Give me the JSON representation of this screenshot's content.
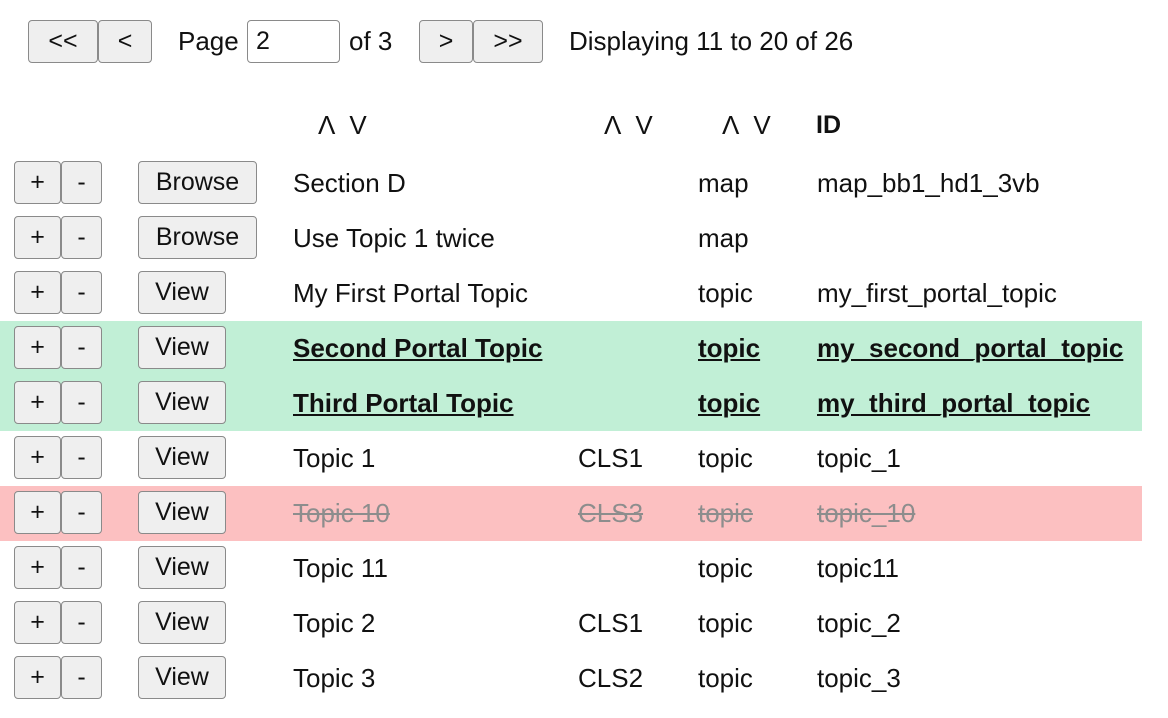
{
  "pager": {
    "first_label": "<<",
    "prev_label": "<",
    "page_label": "Page",
    "page_value": "2",
    "of_label": "of 3",
    "next_label": ">",
    "last_label": ">>",
    "status": "Displaying 11 to 20 of 26"
  },
  "header": {
    "sort_up": "Λ",
    "sort_down": "V",
    "id_label": "ID"
  },
  "rows": [
    {
      "state": "normal",
      "action": "Browse",
      "title": "Section D",
      "cls": "",
      "type": "map",
      "id": "map_bb1_hd1_3vb"
    },
    {
      "state": "normal",
      "action": "Browse",
      "title": "Use Topic 1 twice",
      "cls": "",
      "type": "map",
      "id": ""
    },
    {
      "state": "normal",
      "action": "View",
      "title": "My First Portal Topic",
      "cls": "",
      "type": "topic",
      "id": "my_first_portal_topic"
    },
    {
      "state": "added",
      "action": "View",
      "title": "Second Portal Topic",
      "cls": "",
      "type": "topic",
      "id": "my_second_portal_topic"
    },
    {
      "state": "added",
      "action": "View",
      "title": "Third Portal Topic",
      "cls": "",
      "type": "topic",
      "id": "my_third_portal_topic"
    },
    {
      "state": "normal",
      "action": "View",
      "title": "Topic 1",
      "cls": "CLS1",
      "type": "topic",
      "id": "topic_1"
    },
    {
      "state": "removed",
      "action": "View",
      "title": "Topic 10",
      "cls": "CLS3",
      "type": "topic",
      "id": "topic_10"
    },
    {
      "state": "normal",
      "action": "View",
      "title": "Topic 11",
      "cls": "",
      "type": "topic",
      "id": "topic11"
    },
    {
      "state": "normal",
      "action": "View",
      "title": "Topic 2",
      "cls": "CLS1",
      "type": "topic",
      "id": "topic_2"
    },
    {
      "state": "normal",
      "action": "View",
      "title": "Topic 3",
      "cls": "CLS2",
      "type": "topic",
      "id": "topic_3"
    }
  ],
  "row_buttons": {
    "plus_label": "+",
    "minus_label": "-"
  },
  "colors": {
    "added_row": "#c1efd6",
    "removed_row": "#fcc0c1",
    "button_bg": "#efefef"
  }
}
